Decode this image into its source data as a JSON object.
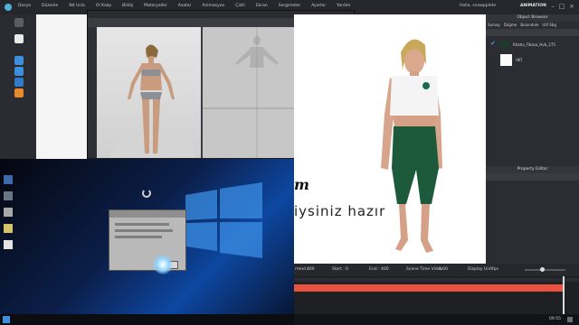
{
  "app": {
    "brand": "ANIMATION",
    "user": "Hello, snowpplete"
  },
  "menu": [
    "Dosya",
    "Düzenle",
    "Nit Ucla",
    "Ol Kalıp",
    "Bildiş",
    "Materyaller",
    "Avatar",
    "Animasyon",
    "Çizili",
    "Ekran",
    "Sergimeler",
    "Ayarlar",
    "Yardım"
  ],
  "object_browser": {
    "title": "Object Browser",
    "tabs": [
      "Sumay",
      "Düğme",
      "Bulundule",
      "Ulif Sbg"
    ],
    "items": [
      {
        "label": "Khatia_Fibasa_Hvb_275",
        "checked": true
      },
      {
        "label": "tIKT",
        "checked": false
      }
    ]
  },
  "property_editor": {
    "title": "Property Editor"
  },
  "viewport_text": {
    "line1": "m",
    "line2": "iysiniz hazır"
  },
  "timeline": {
    "frame_label": "rrend :",
    "frame_value": "400",
    "start_label": "Start :",
    "start_value": "0",
    "end_label": "End :",
    "end_value": "400",
    "scene_time_label": "Scene Time Video",
    "scene_time_value": "1.00",
    "display_unit_label": "Display Unit",
    "display_unit_value": "fps"
  },
  "clock": "09:55"
}
